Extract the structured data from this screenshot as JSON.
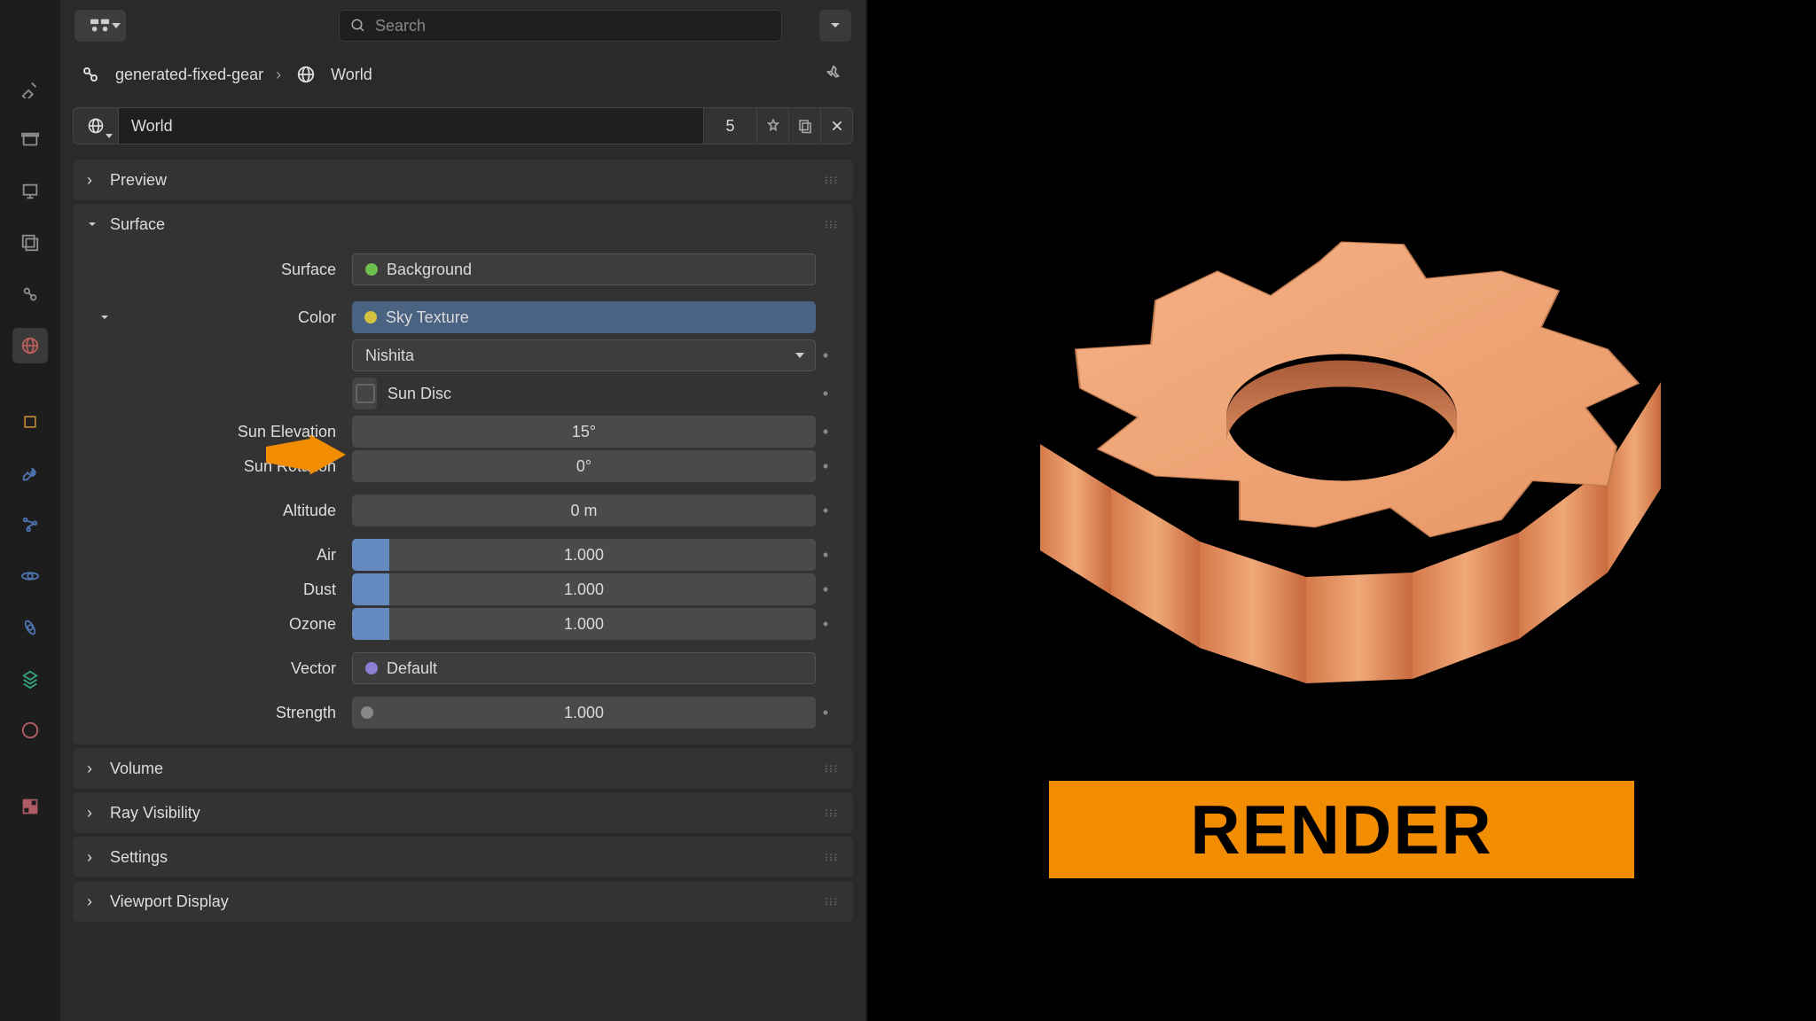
{
  "header": {
    "search_placeholder": "Search"
  },
  "breadcrumb": {
    "scene": "generated-fixed-gear",
    "world": "World"
  },
  "world_row": {
    "name": "World",
    "users": "5"
  },
  "panels": {
    "preview": "Preview",
    "surface": "Surface",
    "volume": "Volume",
    "ray_visibility": "Ray Visibility",
    "settings": "Settings",
    "viewport_display": "Viewport Display"
  },
  "surface": {
    "surface_lbl": "Surface",
    "surface_val": "Background",
    "color_lbl": "Color",
    "color_val": "Sky Texture",
    "model_val": "Nishita",
    "sun_disc_lbl": "Sun Disc",
    "sun_elev_lbl": "Sun Elevation",
    "sun_elev_val": "15°",
    "sun_rot_lbl": "Sun Rotation",
    "sun_rot_val": "0°",
    "altitude_lbl": "Altitude",
    "altitude_val": "0 m",
    "air_lbl": "Air",
    "air_val": "1.000",
    "dust_lbl": "Dust",
    "dust_val": "1.000",
    "ozone_lbl": "Ozone",
    "ozone_val": "1.000",
    "vector_lbl": "Vector",
    "vector_val": "Default",
    "strength_lbl": "Strength",
    "strength_val": "1.000"
  },
  "render_label": "RENDER"
}
